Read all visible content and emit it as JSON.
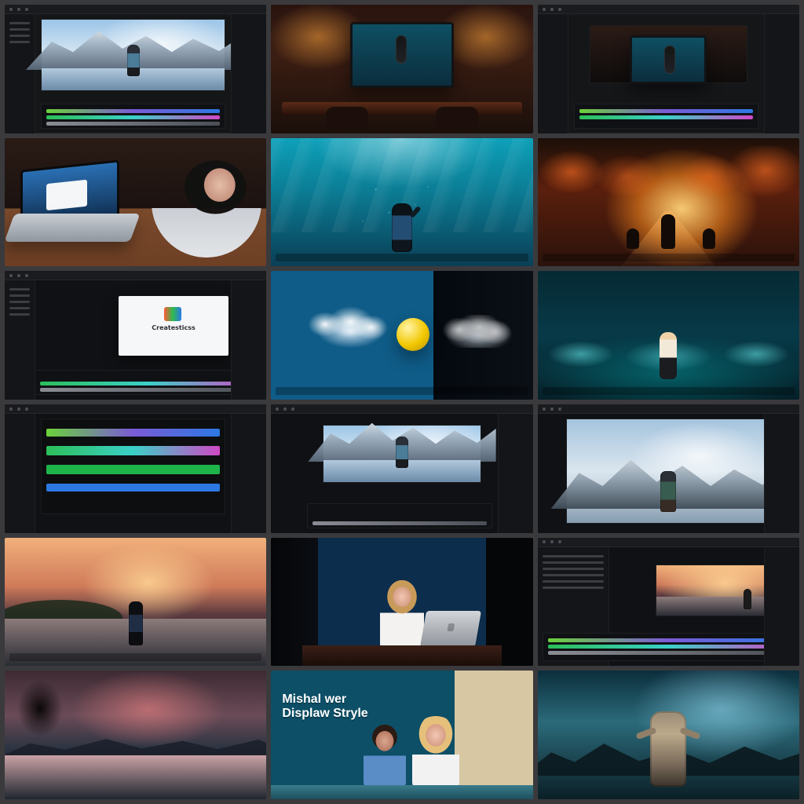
{
  "collage": {
    "tile_06_overlay": {
      "title": "Createsticss"
    },
    "tile_13_overlay": {
      "line1": "Mishal wer",
      "line2": "Displaw Stryle"
    }
  },
  "colors": {
    "frame_bg": "#3a3a3d",
    "editor_bg": "#151618",
    "timeline_green": "#2cbf59",
    "timeline_blue": "#2c79e4",
    "timeline_purple": "#7b5bd6"
  },
  "icons": {
    "dot": "circle",
    "panel_lines": "horizontal-lines"
  }
}
